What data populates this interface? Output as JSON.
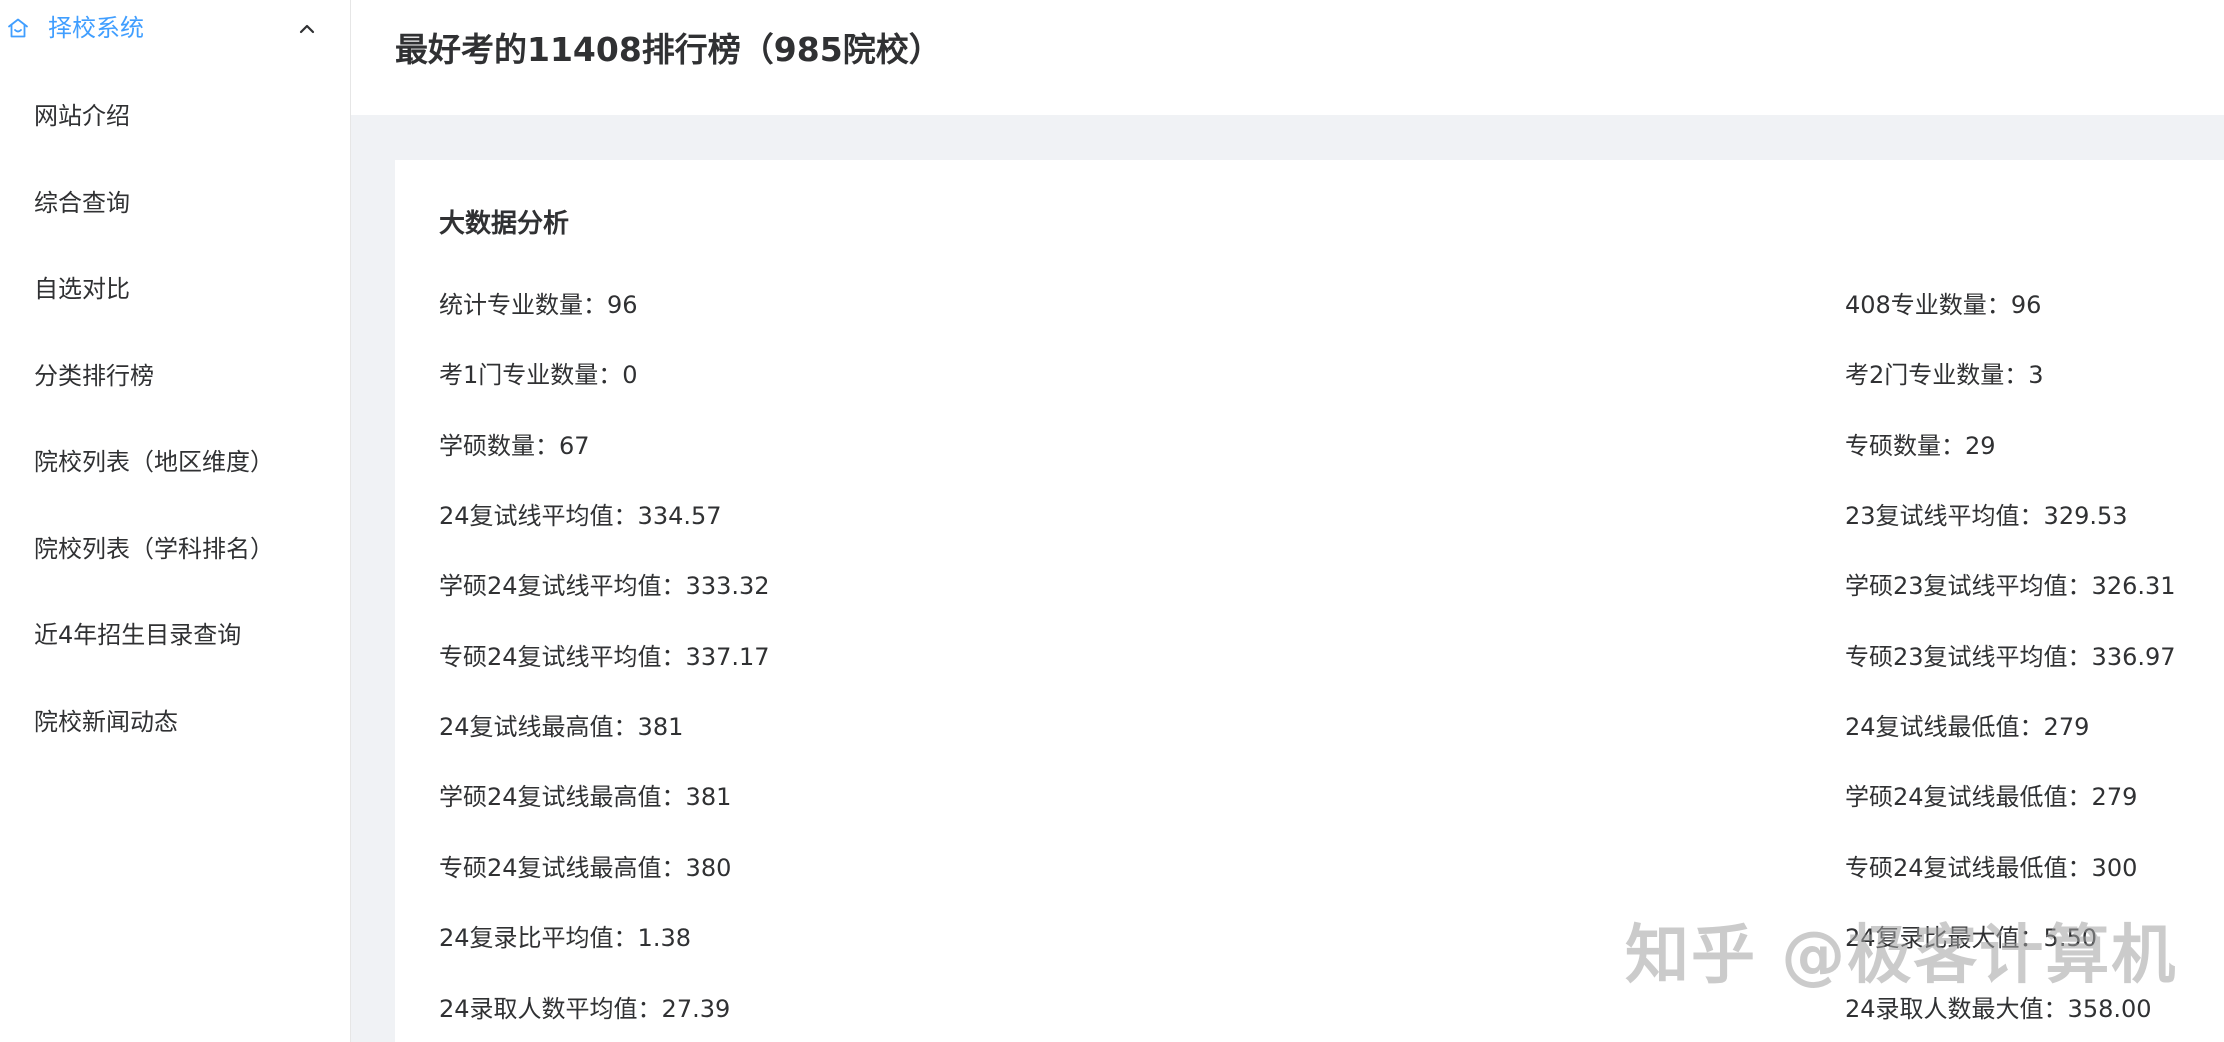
{
  "sidebar": {
    "section_title": "择校系统",
    "items": [
      {
        "label": "网站介绍"
      },
      {
        "label": "综合查询"
      },
      {
        "label": "自选对比"
      },
      {
        "label": "分类排行榜"
      },
      {
        "label": "院校列表（地区维度）"
      },
      {
        "label": "院校列表（学科排名）"
      },
      {
        "label": "近4年招生目录查询"
      },
      {
        "label": "院校新闻动态"
      }
    ]
  },
  "header": {
    "title": "最好考的11408排行榜（985院校）"
  },
  "analysis": {
    "title": "大数据分析",
    "left": [
      {
        "label": "统计专业数量：",
        "value": "96"
      },
      {
        "label": "考1门专业数量：",
        "value": "0"
      },
      {
        "label": "学硕数量：",
        "value": "67"
      },
      {
        "label": "24复试线平均值：",
        "value": "334.57"
      },
      {
        "label": "学硕24复试线平均值：",
        "value": "333.32"
      },
      {
        "label": "专硕24复试线平均值：",
        "value": "337.17"
      },
      {
        "label": "24复试线最高值：",
        "value": "381"
      },
      {
        "label": "学硕24复试线最高值：",
        "value": "381"
      },
      {
        "label": "专硕24复试线最高值：",
        "value": "380"
      },
      {
        "label": "24复录比平均值：",
        "value": "1.38"
      },
      {
        "label": "24录取人数平均值：",
        "value": "27.39"
      }
    ],
    "right": [
      {
        "label": "408专业数量：",
        "value": "96"
      },
      {
        "label": "考2门专业数量：",
        "value": "3"
      },
      {
        "label": "专硕数量：",
        "value": "29"
      },
      {
        "label": "23复试线平均值：",
        "value": "329.53"
      },
      {
        "label": "学硕23复试线平均值：",
        "value": "326.31"
      },
      {
        "label": "专硕23复试线平均值：",
        "value": "336.97"
      },
      {
        "label": "24复试线最低值：",
        "value": "279"
      },
      {
        "label": "学硕24复试线最低值：",
        "value": "279"
      },
      {
        "label": "专硕24复试线最低值：",
        "value": "300"
      },
      {
        "label": "24复录比最大值：",
        "value": "5.50"
      },
      {
        "label": "24录取人数最大值：",
        "value": "358.00"
      }
    ]
  },
  "watermark": "知乎 @极客计算机",
  "colors": {
    "accent": "#409eff",
    "background": "#f0f2f5",
    "text": "#303133"
  },
  "icons": {
    "section": "home-icon",
    "collapse": "chevron-up-icon"
  }
}
